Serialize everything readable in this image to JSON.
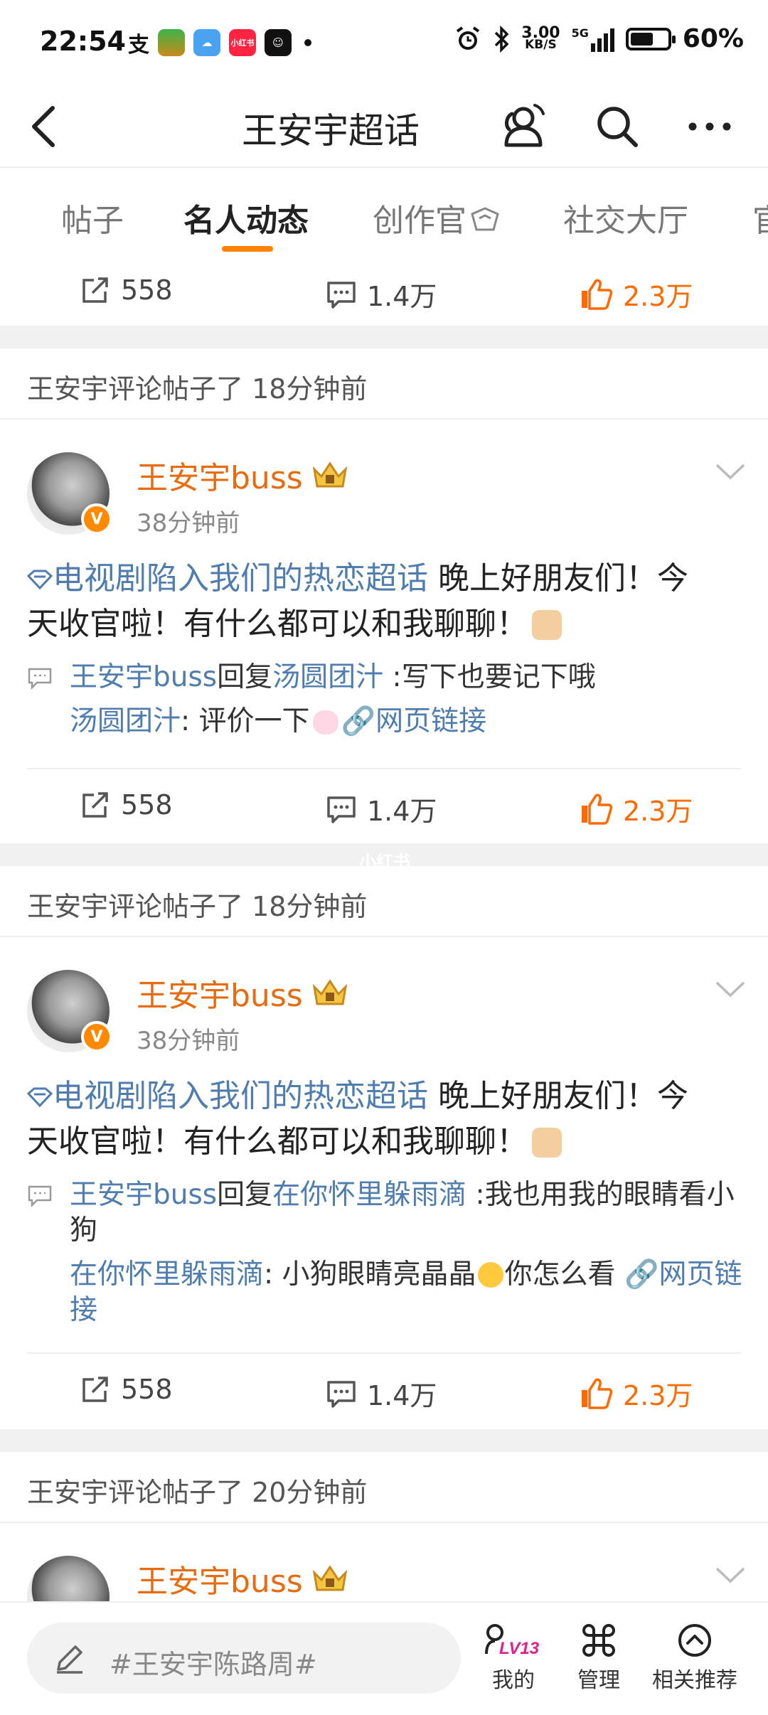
{
  "status_bar": {
    "time": "22:54",
    "app_icons": [
      "alipay-icon",
      "game-icon",
      "weather-icon",
      "xiaohongshu-icon",
      "smile-app-icon"
    ],
    "xiaohongshu_label": "小红书",
    "net_speed": "3.00",
    "net_unit": "KB/S",
    "network": "5G",
    "battery": "60%",
    "battery_level": 0.6
  },
  "header": {
    "title": "王安宇超话"
  },
  "tabs": [
    {
      "label": "帖子"
    },
    {
      "label": "名人动态"
    },
    {
      "label": "创作官"
    },
    {
      "label": "社交大厅"
    },
    {
      "label": "官"
    }
  ],
  "active_tab_index": 1,
  "top_actions": {
    "repost": "558",
    "comment": "1.4万",
    "like": "2.3万"
  },
  "feed": [
    {
      "notice": "王安宇评论帖子了 18分钟前",
      "author": "王安宇buss",
      "time": "38分钟前",
      "topic": "电视剧陷入我们的热恋超话",
      "text_line1": "  晚上好朋友们！今",
      "text_line2": "天收官啦！有什么都可以和我聊聊！",
      "reply_from": "王安宇buss",
      "reply_word": "回复",
      "reply_to": "汤圆团汁",
      "reply_text": " :写下也要记下哦",
      "orig_user": "汤圆团汁",
      "orig_text": ": 评价一下",
      "link_text": "网页链接",
      "repost": "558",
      "comment": "1.4万",
      "like": "2.3万"
    },
    {
      "notice": "王安宇评论帖子了 18分钟前",
      "author": "王安宇buss",
      "time": "38分钟前",
      "topic": "电视剧陷入我们的热恋超话",
      "text_line1": "  晚上好朋友们！今",
      "text_line2": "天收官啦！有什么都可以和我聊聊！",
      "reply_from": "王安宇buss",
      "reply_word": "回复",
      "reply_to": "在你怀里躲雨滴",
      "reply_text": " :我也用我的眼睛看小狗",
      "orig_user": "在你怀里躲雨滴",
      "orig_text": ": 小狗眼睛亮晶晶",
      "orig_text2": "你怎么看 ",
      "link_text": "网页链接",
      "repost": "558",
      "comment": "1.4万",
      "like": "2.3万"
    },
    {
      "notice": "王安宇评论帖子了 20分钟前",
      "author": "王安宇buss"
    }
  ],
  "watermark": "小红书",
  "bottom_bar": {
    "composer_placeholder": "#王安宇陈路周#",
    "level_badge": "LV13",
    "nav": [
      {
        "label": "我的",
        "icon": "profile-level-icon"
      },
      {
        "label": "管理",
        "icon": "command-icon"
      },
      {
        "label": "相关推荐",
        "icon": "chevron-up-circle-icon"
      }
    ]
  },
  "colors": {
    "accent": "#ff8200",
    "author": "#e86c0f",
    "link": "#507daf",
    "like": "#ff6a00",
    "separator": "#f1f1f1"
  }
}
